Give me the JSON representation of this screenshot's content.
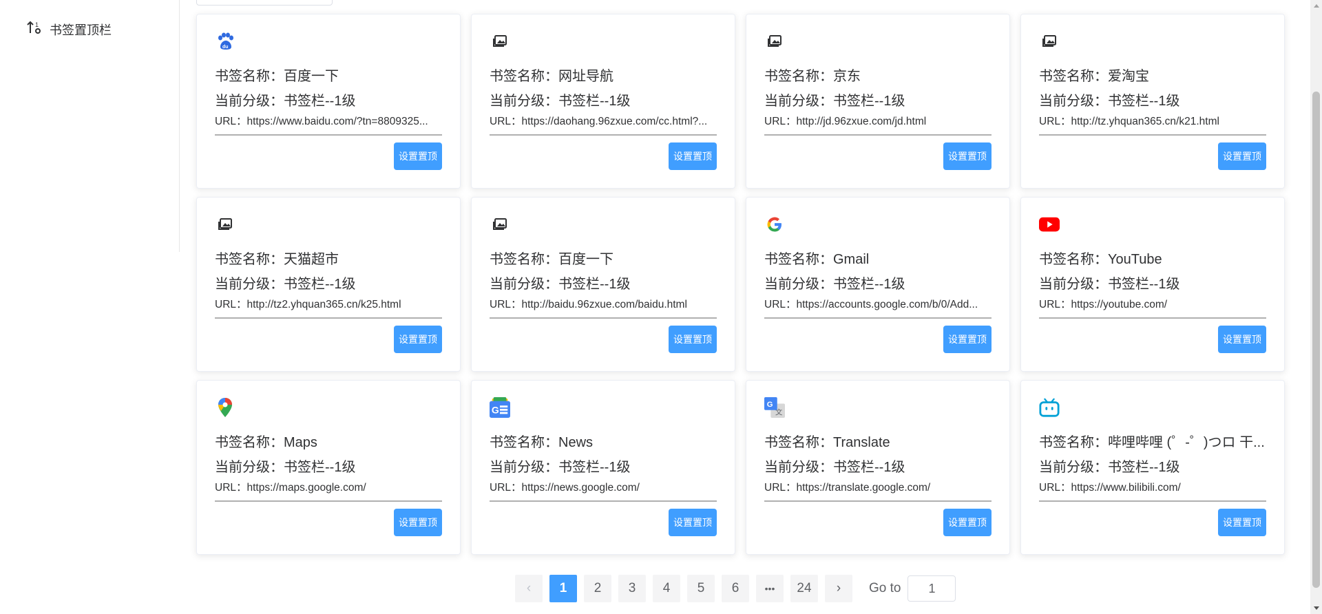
{
  "sidebar": {
    "items": [
      {
        "label": "书签置顶栏",
        "icon": "sort-numeric-icon"
      }
    ]
  },
  "cards": [
    {
      "icon": "baidu-paw-icon",
      "name": "书签名称：百度一下",
      "level": "当前分级：书签栏--1级",
      "url": "URL：https://www.baidu.com/?tn=8809325...",
      "button": "设置置顶"
    },
    {
      "icon": "image-placeholder-icon",
      "name": "书签名称：网址导航",
      "level": "当前分级：书签栏--1级",
      "url": "URL：https://daohang.96zxue.com/cc.html?...",
      "button": "设置置顶"
    },
    {
      "icon": "image-placeholder-icon",
      "name": "书签名称：京东",
      "level": "当前分级：书签栏--1级",
      "url": "URL：http://jd.96zxue.com/jd.html",
      "button": "设置置顶"
    },
    {
      "icon": "image-placeholder-icon",
      "name": "书签名称：爱淘宝",
      "level": "当前分级：书签栏--1级",
      "url": "URL：http://tz.yhquan365.cn/k21.html",
      "button": "设置置顶"
    },
    {
      "icon": "image-placeholder-icon",
      "name": "书签名称：天猫超市",
      "level": "当前分级：书签栏--1级",
      "url": "URL：http://tz2.yhquan365.cn/k25.html",
      "button": "设置置顶"
    },
    {
      "icon": "image-placeholder-icon",
      "name": "书签名称：百度一下",
      "level": "当前分级：书签栏--1级",
      "url": "URL：http://baidu.96zxue.com/baidu.html",
      "button": "设置置顶"
    },
    {
      "icon": "google-icon",
      "name": "书签名称：Gmail",
      "level": "当前分级：书签栏--1级",
      "url": "URL：https://accounts.google.com/b/0/Add...",
      "button": "设置置顶"
    },
    {
      "icon": "youtube-icon",
      "name": "书签名称：YouTube",
      "level": "当前分级：书签栏--1级",
      "url": "URL：https://youtube.com/",
      "button": "设置置顶"
    },
    {
      "icon": "google-maps-icon",
      "name": "书签名称：Maps",
      "level": "当前分级：书签栏--1级",
      "url": "URL：https://maps.google.com/",
      "button": "设置置顶"
    },
    {
      "icon": "google-news-icon",
      "name": "书签名称：News",
      "level": "当前分级：书签栏--1级",
      "url": "URL：https://news.google.com/",
      "button": "设置置顶"
    },
    {
      "icon": "google-translate-icon",
      "name": "书签名称：Translate",
      "level": "当前分级：书签栏--1级",
      "url": "URL：https://translate.google.com/",
      "button": "设置置顶"
    },
    {
      "icon": "bilibili-icon",
      "name": "书签名称：哔哩哔哩 (゜-゜)つロ 干...",
      "level": "当前分级：书签栏--1级",
      "url": "URL：https://www.bilibili.com/",
      "button": "设置置顶"
    }
  ],
  "pagination": {
    "prev": "‹",
    "pages": [
      "1",
      "2",
      "3",
      "4",
      "5",
      "6",
      "•••",
      "24"
    ],
    "current": "1",
    "next": "›",
    "goto_label": "Go to",
    "goto_value": "1"
  },
  "colors": {
    "primary": "#409eff",
    "pager_bg": "#f4f4f5"
  }
}
